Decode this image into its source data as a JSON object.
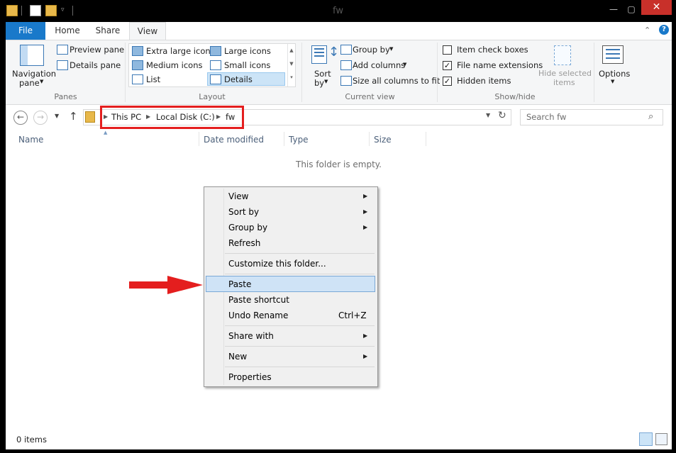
{
  "window": {
    "title": "fw",
    "minimize": "—",
    "maximize": "▢",
    "close": "✕"
  },
  "tabs": {
    "file": "File",
    "home": "Home",
    "share": "Share",
    "view": "View"
  },
  "ribbon": {
    "panes": {
      "navigation_pane": "Navigation",
      "navigation_pane2": "pane",
      "preview_pane": "Preview pane",
      "details_pane": "Details pane",
      "group_label": "Panes"
    },
    "layout": {
      "extra_large_icons": "Extra large icons",
      "large_icons": "Large icons",
      "medium_icons": "Medium icons",
      "small_icons": "Small icons",
      "list": "List",
      "details": "Details",
      "group_label": "Layout"
    },
    "current_view": {
      "sort_by": "Sort",
      "sort_by2": "by",
      "group_by": "Group by",
      "add_columns": "Add columns",
      "size_all_columns": "Size all columns to fit",
      "group_label": "Current view"
    },
    "show_hide": {
      "item_check_boxes": "Item check boxes",
      "item_check_boxes_checked": false,
      "file_name_extensions": "File name extensions",
      "file_name_extensions_checked": true,
      "hidden_items": "Hidden items",
      "hidden_items_checked": true,
      "hide_selected": "Hide selected",
      "hide_selected2": "items",
      "group_label": "Show/hide"
    },
    "options": "Options"
  },
  "address": {
    "crumbs": [
      "This PC",
      "Local Disk (C:)",
      "fw"
    ],
    "search_placeholder": "Search fw"
  },
  "columns": {
    "name": "Name",
    "date_modified": "Date modified",
    "type": "Type",
    "size": "Size"
  },
  "content": {
    "empty_message": "This folder is empty."
  },
  "status": {
    "items": "0 items"
  },
  "context_menu": {
    "view": "View",
    "sort_by": "Sort by",
    "group_by": "Group by",
    "refresh": "Refresh",
    "customize": "Customize this folder...",
    "paste": "Paste",
    "paste_shortcut": "Paste shortcut",
    "undo_rename": "Undo Rename",
    "undo_shortcut": "Ctrl+Z",
    "share_with": "Share with",
    "new": "New",
    "properties": "Properties"
  },
  "colors": {
    "file_tab": "#1979ca",
    "close": "#c8302a",
    "annotation": "#e41e1e",
    "highlight": "#cfe3f6"
  }
}
